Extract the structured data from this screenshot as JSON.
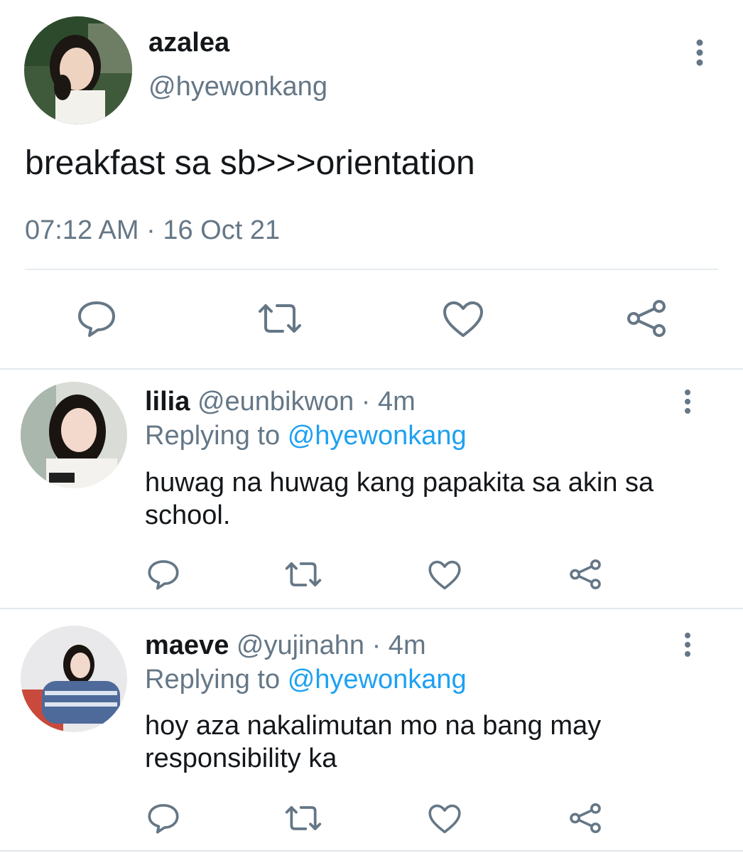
{
  "tweet": {
    "display_name": "azalea",
    "handle": "@hyewonkang",
    "text": "breakfast sa sb>>>orientation",
    "timestamp": "07:12 AM · 16 Oct 21"
  },
  "replies": [
    {
      "display_name": "lilia",
      "handle": "@eunbikwon",
      "time": "· 4m",
      "replying_prefix": "Replying to",
      "replying_to": "@hyewonkang",
      "text": "huwag na huwag kang papakita sa akin sa school."
    },
    {
      "display_name": "maeve",
      "handle": "@yujinahn",
      "time": "· 4m",
      "replying_prefix": "Replying to",
      "replying_to": "@hyewonkang",
      "text": "hoy aza nakalimutan mo na bang may responsibility ka"
    }
  ],
  "icons": {
    "reply": "speech-bubble-icon",
    "retweet": "retweet-arrows-icon",
    "like": "heart-icon",
    "share": "share-nodes-icon",
    "more": "vertical-dots-icon"
  },
  "colors": {
    "text": "#14171a",
    "secondary": "#657786",
    "link": "#1da1f2",
    "divider": "#e1e8ed"
  }
}
